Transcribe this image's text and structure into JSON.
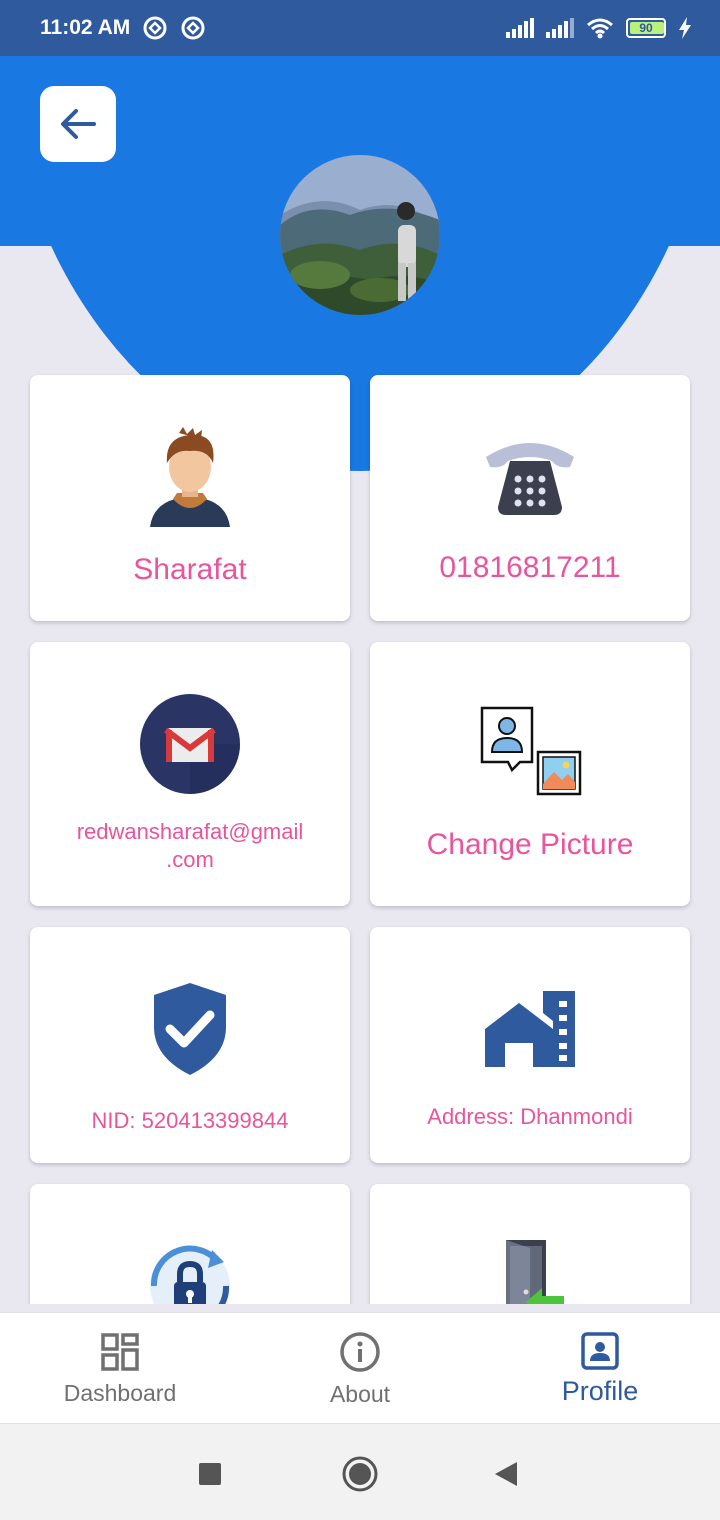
{
  "status_bar": {
    "time": "11:02 AM",
    "battery": "90"
  },
  "header": {
    "back_icon": "arrow-left-icon",
    "avatar": "profile-photo"
  },
  "cards": [
    {
      "id": "name",
      "label": "Sharafat",
      "icon": "user-avatar-icon"
    },
    {
      "id": "phone",
      "label": "01816817211",
      "icon": "telephone-icon"
    },
    {
      "id": "email",
      "label_line1": "redwansharafat@gmail",
      "label_line2": ".com",
      "icon": "gmail-icon"
    },
    {
      "id": "change_picture",
      "label": "Change Picture",
      "icon": "change-picture-icon"
    },
    {
      "id": "nid",
      "label": "NID: 520413399844",
      "icon": "shield-check-icon"
    },
    {
      "id": "address",
      "label": "Address: Dhanmondi",
      "icon": "house-icon"
    },
    {
      "id": "password",
      "label": "",
      "icon": "lock-refresh-icon"
    },
    {
      "id": "logout",
      "label": "",
      "icon": "logout-door-icon"
    }
  ],
  "bottom_nav": {
    "items": [
      {
        "label": "Dashboard",
        "icon": "dashboard-grid-icon",
        "active": false
      },
      {
        "label": "About",
        "icon": "info-icon",
        "active": false
      },
      {
        "label": "Profile",
        "icon": "profile-badge-icon",
        "active": true
      }
    ]
  },
  "colors": {
    "header": "#1a78e2",
    "status_bar": "#2f5a9e",
    "label": "#e8559c",
    "background": "#e9e7f0"
  }
}
